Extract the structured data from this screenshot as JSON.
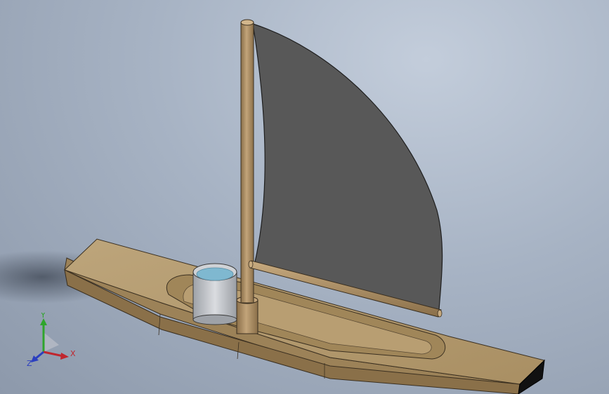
{
  "viewport": {
    "background_top": "#c3cddb",
    "background_bottom": "#8d99ab"
  },
  "model": {
    "hull_color": "#b59a6f",
    "hull_shade": "#8c7450",
    "sail_color": "#585858",
    "mast_color": "#a88a60",
    "water_color": "#7fb8d0",
    "bucket_color": "#b9bcc2"
  },
  "triad": {
    "x_label": "X",
    "y_label": "Y",
    "z_label": "Z",
    "x_color": "#c0262e",
    "y_color": "#2fa52c",
    "z_color": "#2b3fbf"
  }
}
